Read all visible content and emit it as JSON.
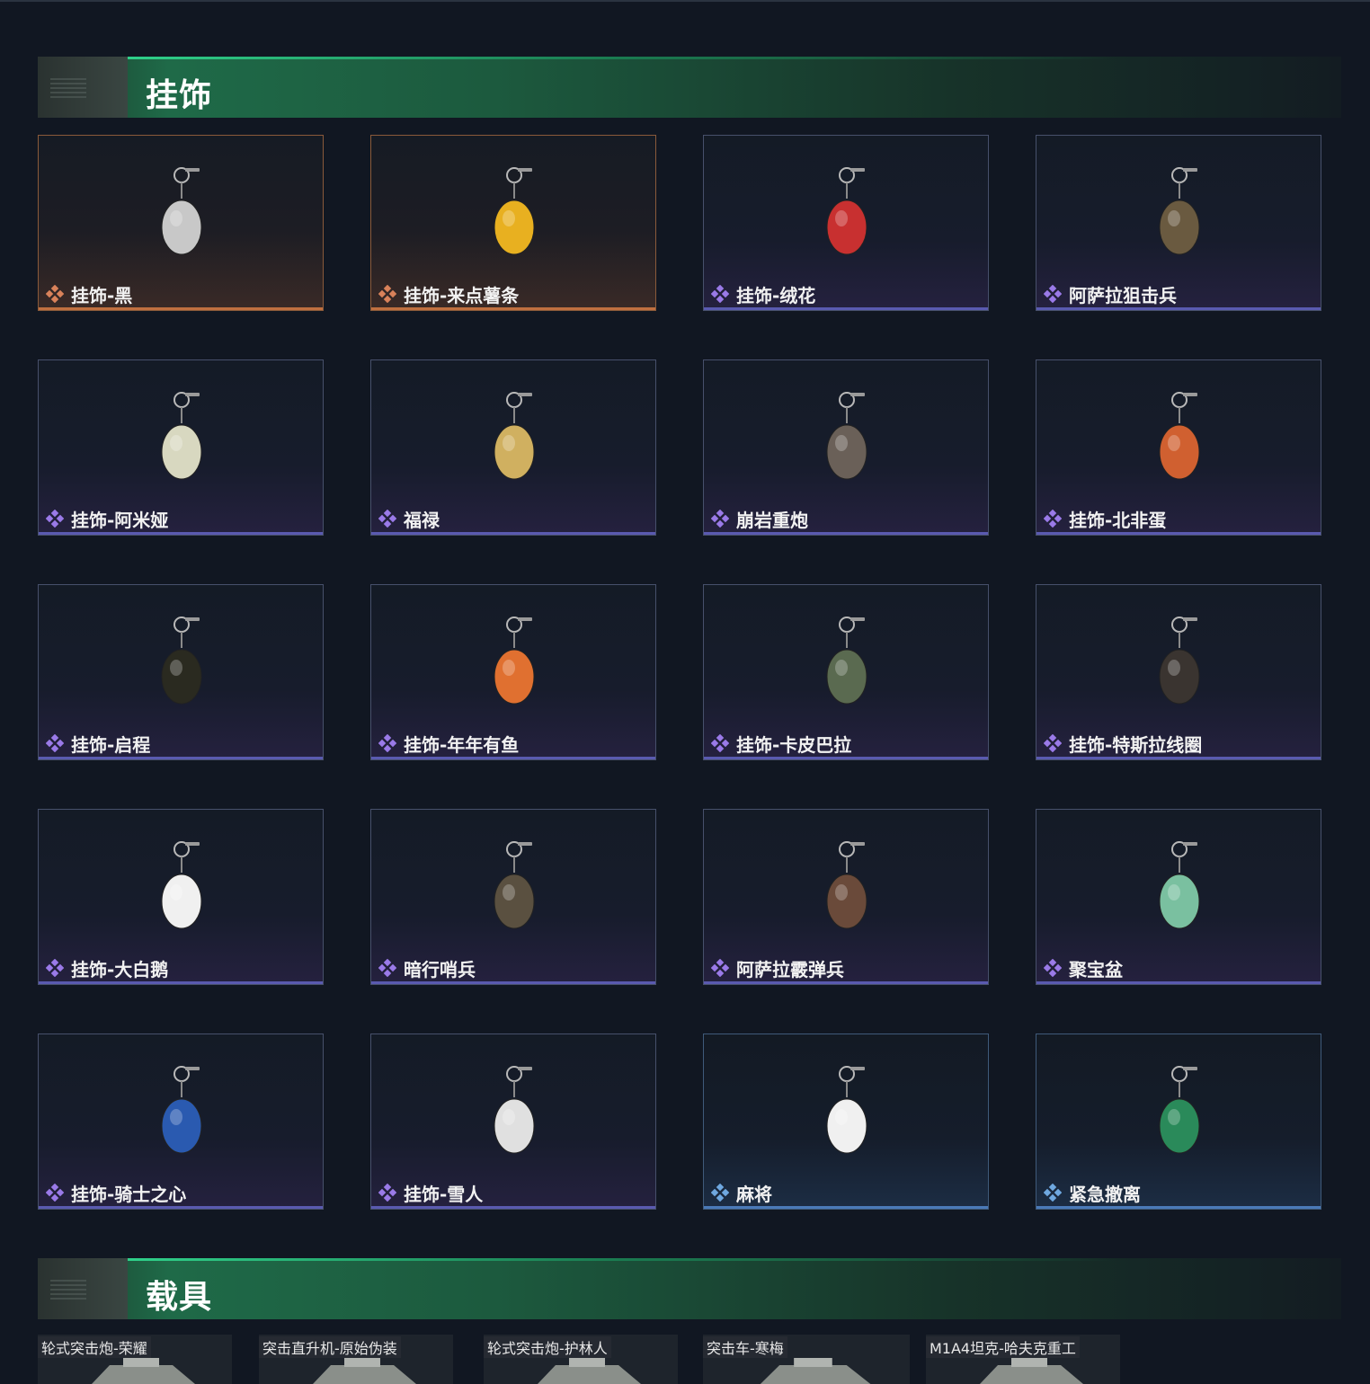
{
  "sections": {
    "charms_title": "挂饰",
    "vehicles_title": "载具"
  },
  "charms": [
    {
      "label": "挂饰-黑",
      "rarity": "orange"
    },
    {
      "label": "挂饰-来点薯条",
      "rarity": "orange"
    },
    {
      "label": "挂饰-绒花",
      "rarity": "purple"
    },
    {
      "label": "阿萨拉狙击兵",
      "rarity": "purple"
    },
    {
      "label": "挂饰-阿米娅",
      "rarity": "purple"
    },
    {
      "label": "福禄",
      "rarity": "purple"
    },
    {
      "label": "崩岩重炮",
      "rarity": "purple"
    },
    {
      "label": "挂饰-北非蛋",
      "rarity": "purple"
    },
    {
      "label": "挂饰-启程",
      "rarity": "purple"
    },
    {
      "label": "挂饰-年年有鱼",
      "rarity": "purple"
    },
    {
      "label": "挂饰-卡皮巴拉",
      "rarity": "purple"
    },
    {
      "label": "挂饰-特斯拉线圈",
      "rarity": "purple"
    },
    {
      "label": "挂饰-大白鹅",
      "rarity": "purple"
    },
    {
      "label": "暗行哨兵",
      "rarity": "purple"
    },
    {
      "label": "阿萨拉霰弹兵",
      "rarity": "purple"
    },
    {
      "label": "聚宝盆",
      "rarity": "purple"
    },
    {
      "label": "挂饰-骑士之心",
      "rarity": "purple"
    },
    {
      "label": "挂饰-雪人",
      "rarity": "purple"
    },
    {
      "label": "麻将",
      "rarity": "blue"
    },
    {
      "label": "紧急撤离",
      "rarity": "blue"
    }
  ],
  "vehicles": [
    {
      "label": "轮式突击炮-荣耀"
    },
    {
      "label": "突击直升机-原始伪装"
    },
    {
      "label": "轮式突击炮-护林人"
    },
    {
      "label": "突击车-寒梅"
    },
    {
      "label": "M1A4坦克-哈夫克重工"
    }
  ],
  "colors": {
    "orange": "#d9825a",
    "purple": "#9a7ae8",
    "blue": "#6fa8e0",
    "header_green": "#1f6a48"
  }
}
